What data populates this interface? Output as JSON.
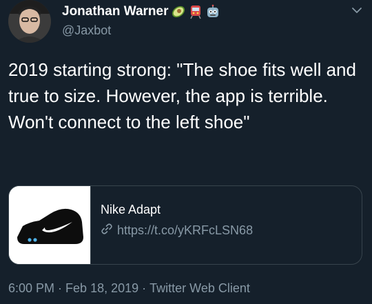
{
  "author": {
    "display_name": "Jonathan Warner",
    "handle": "@Jaxbot",
    "name_emojis": [
      "avocado-emoji",
      "train-emoji",
      "robot-emoji"
    ]
  },
  "tweet": {
    "text": "2019 starting strong: \"The shoe fits well and true to size. However, the app is terrible. Won't connect to the left shoe\""
  },
  "card": {
    "title": "Nike Adapt",
    "link": "https://t.co/yKRFcLSN68",
    "link_icon": "link-icon",
    "thumbnail": "nike-shoe-image"
  },
  "meta": {
    "time": "6:00 PM",
    "separator": " · ",
    "date": "Feb 18, 2019",
    "source": "Twitter Web Client"
  },
  "menu_icon": "chevron-down-icon",
  "colors": {
    "background": "#15202b",
    "text": "#ffffff",
    "secondary_text": "#8899a6",
    "border": "#38444d"
  }
}
